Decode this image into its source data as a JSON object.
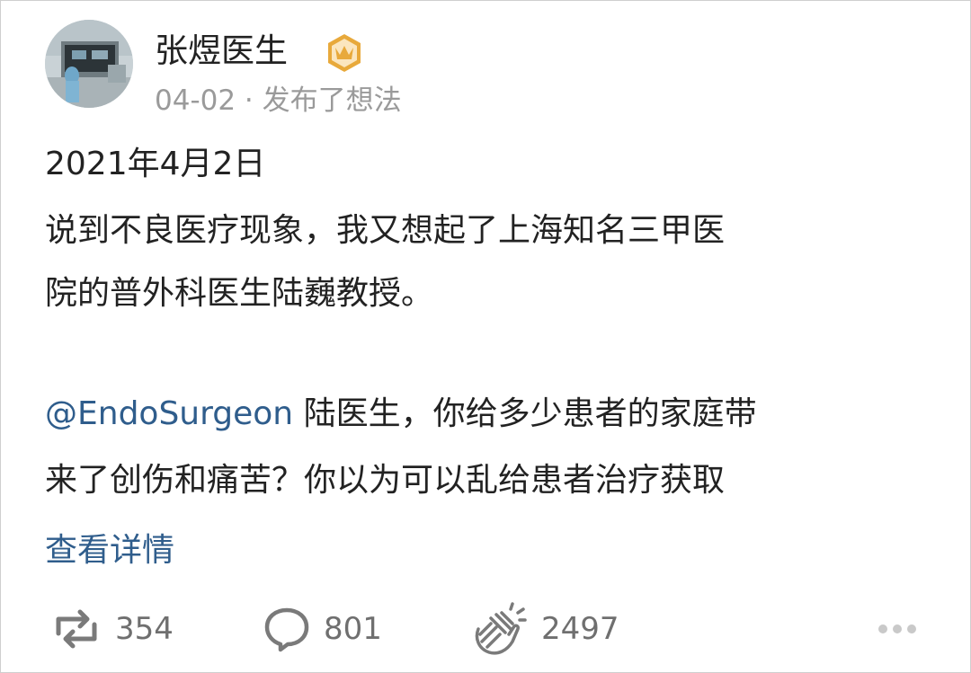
{
  "post": {
    "author": "张煜医生",
    "meta": "04-02 · 发布了想法",
    "date_line": "2021年4月2日",
    "line2": "说到不良医疗现象，我又想起了上海知名三甲医",
    "line3": "院的普外科医生陆巍教授。",
    "mention": "@EndoSurgeon",
    "line4_rest": " 陆医生，你给多少患者的家庭带",
    "line5": "来了创伤和痛苦？你以为可以乱给患者治疗获取",
    "read_more": "查看详情"
  },
  "actions": {
    "repost_count": "354",
    "comment_count": "801",
    "like_count": "2497"
  },
  "icons": {
    "badge": "verified-crown-badge-icon",
    "repost": "repost-icon",
    "comment": "comment-bubble-icon",
    "like": "clapping-hands-icon",
    "more": "more-dots-icon"
  },
  "colors": {
    "link": "#2f5d8c",
    "badge": "#e8a93b",
    "muted": "#9a9a9a"
  }
}
